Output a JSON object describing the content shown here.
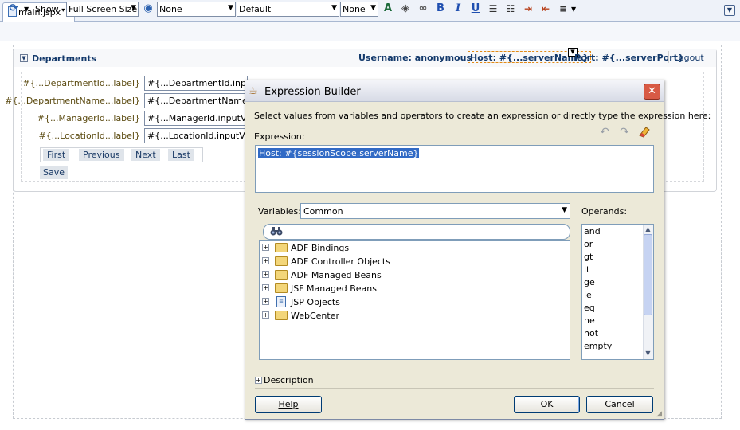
{
  "tab": {
    "label": "main.jspx"
  },
  "toolbar": {
    "show_label": "Show",
    "screen_size": "Full Screen Size",
    "style_class": "None",
    "font": "Default",
    "size": "None",
    "bold": "B",
    "italic": "I",
    "underline": "U"
  },
  "panel": {
    "title": "Departments",
    "username": "Username: anonymous",
    "host": "Host: #{...serverName}",
    "port": "Port: #{...serverPort}",
    "logout": "Logout"
  },
  "form": {
    "fields": [
      {
        "label": "#{...DepartmentId...label}",
        "value": "#{...DepartmentId.inputValue}"
      },
      {
        "label": "#{...DepartmentName...label}",
        "value": "#{...DepartmentName.inputValue}"
      },
      {
        "label": "#{...ManagerId...label}",
        "value": "#{...ManagerId.inputValue}"
      },
      {
        "label": "#{...LocationId...label}",
        "value": "#{...LocationId.inputValue}"
      }
    ],
    "nav": {
      "first": "First",
      "previous": "Previous",
      "next": "Next",
      "last": "Last"
    },
    "save": "Save"
  },
  "dialog": {
    "title": "Expression Builder",
    "instructions": "Select values from variables and operators to create an expression or directly type the expression here:",
    "expression_label": "Expression:",
    "expression_value": "Host: #{sessionScope.serverName}",
    "variables_label": "Variables:",
    "variables_selected": "Common",
    "tree": [
      {
        "label": "ADF Bindings",
        "icon": "folder"
      },
      {
        "label": "ADF Controller Objects",
        "icon": "folder"
      },
      {
        "label": "ADF Managed Beans",
        "icon": "folder"
      },
      {
        "label": "JSF Managed Beans",
        "icon": "folder"
      },
      {
        "label": "JSP Objects",
        "icon": "page"
      },
      {
        "label": "WebCenter",
        "icon": "folder"
      }
    ],
    "operands_label": "Operands:",
    "operands": [
      "and",
      "or",
      "gt",
      "lt",
      "ge",
      "le",
      "eq",
      "ne",
      "not",
      "empty"
    ],
    "description_label": "Description",
    "help": "Help",
    "ok": "OK",
    "cancel": "Cancel"
  },
  "colors": {
    "accent_blue": "#13396b",
    "label_brown": "#5b4a10",
    "selection": "#316ac5",
    "host_outline": "#e28b17",
    "close_button": "#d85a45"
  }
}
